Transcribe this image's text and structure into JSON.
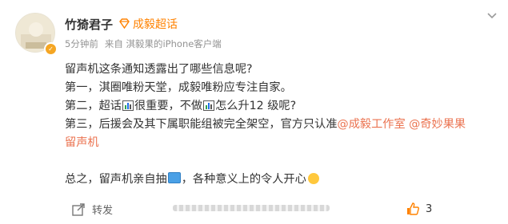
{
  "post": {
    "author": "竹猗君子",
    "topic": "成毅超话",
    "time": "5分钟前",
    "source_prefix": "来自",
    "source": "淇毅果的iPhone客户端",
    "lines": [
      {
        "text": "留声机这条通知透露出了哪些信息呢?"
      },
      {
        "text": "第一，淇圈唯粉天堂，成毅唯粉应专注自家。"
      },
      {
        "part1": "第二，超话",
        "part2": "很重要，不做",
        "part3": "怎么升12 级呢?"
      },
      {
        "text": "第三，后援会及其下属职能组被完全架空，官方只认准",
        "link1": "@成毅工作室",
        "link2": "@奇妙果果"
      },
      {
        "text": "留声机"
      },
      {
        "part1": "总之，留声机亲自抽",
        "part2": "，各种意义上的令人开心"
      }
    ]
  },
  "footer": {
    "repost_label": "转发",
    "like_count": "3"
  },
  "colors": {
    "accent": "#ff8200",
    "link": "#eb7350",
    "meta": "#939393"
  },
  "icons": [
    "verified-badge-icon",
    "topic-diamond-icon",
    "more-menu-icon",
    "bar-chart-icon",
    "ticket-emoji-icon",
    "happy-face-emoji-icon",
    "repost-icon",
    "like-icon"
  ]
}
